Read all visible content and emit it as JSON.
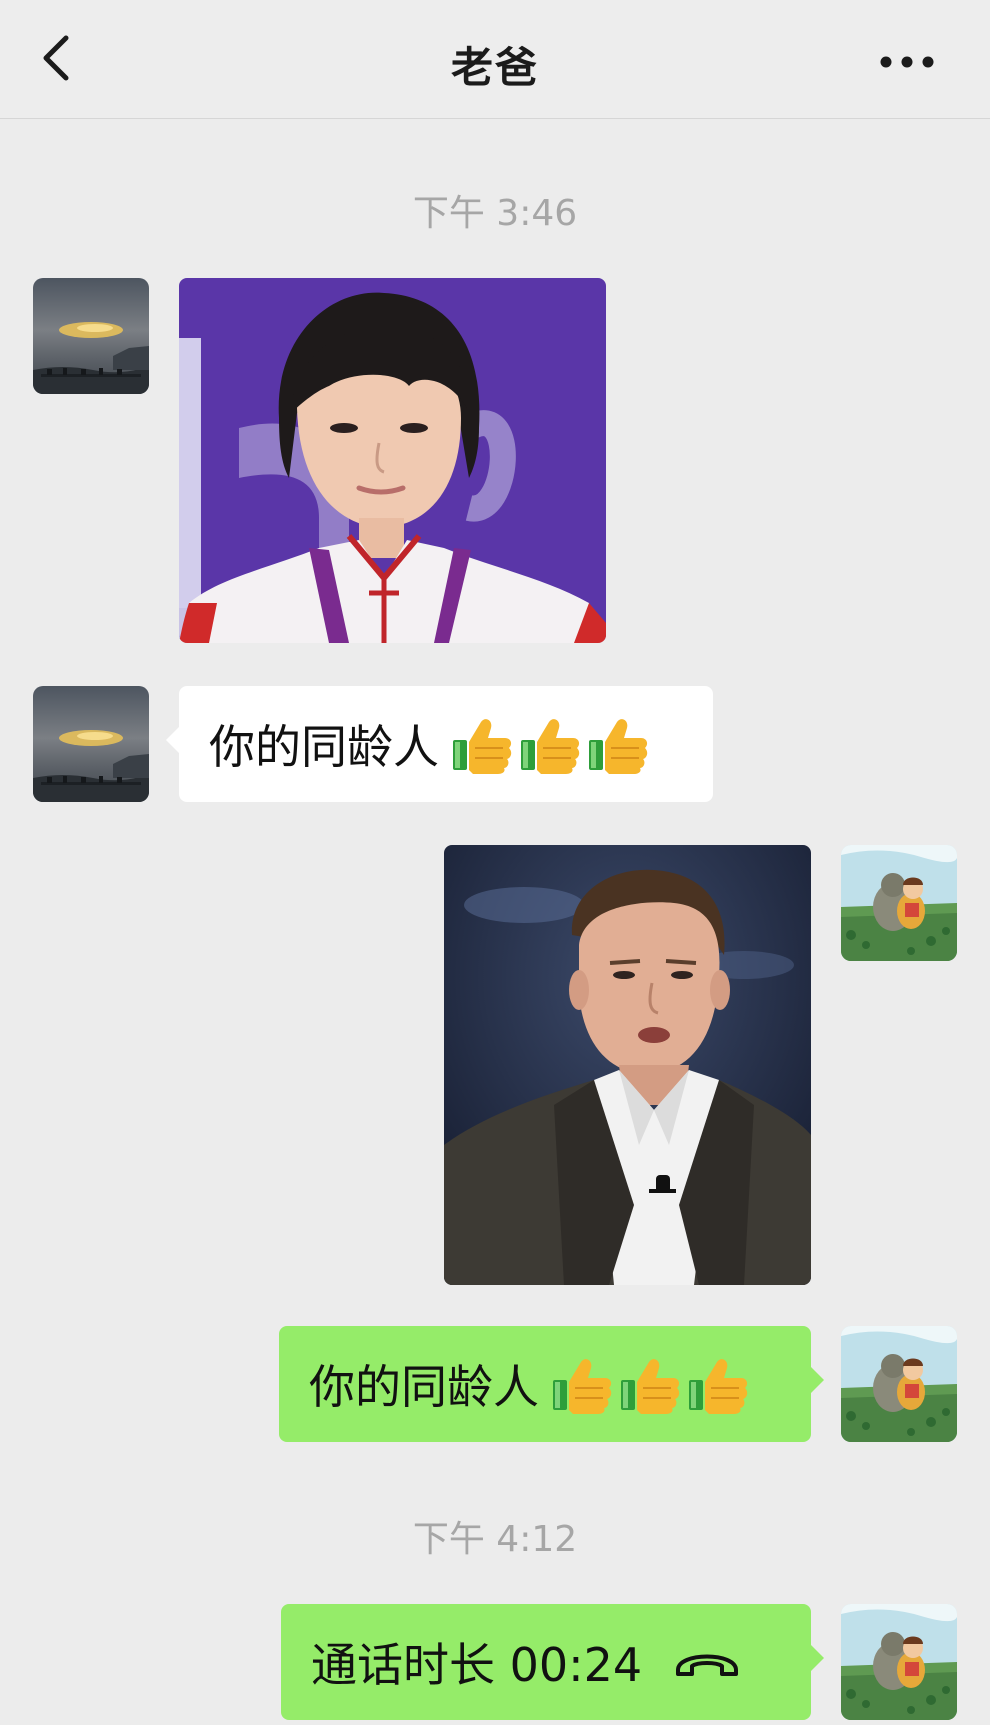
{
  "header": {
    "title": "老爸",
    "back_icon": "chevron-left-icon",
    "more_icon": "more-dots-icon"
  },
  "messages": {
    "timestamp_1": "下午 3:46",
    "msg_1_type": "image",
    "msg_2_text": "你的同龄人",
    "msg_2_emoji": "thumbs-up x3",
    "msg_3_type": "image",
    "msg_4_text": "你的同龄人",
    "msg_4_emoji": "thumbs-up x3",
    "timestamp_2": "下午 4:12",
    "msg_5_text": "通话时长 00:24",
    "msg_5_icon": "phone-hangup-icon"
  },
  "colors": {
    "background": "#ececec",
    "sent_bubble": "#95ec69",
    "received_bubble": "#ffffff",
    "timestamp": "#a6a6a6"
  }
}
